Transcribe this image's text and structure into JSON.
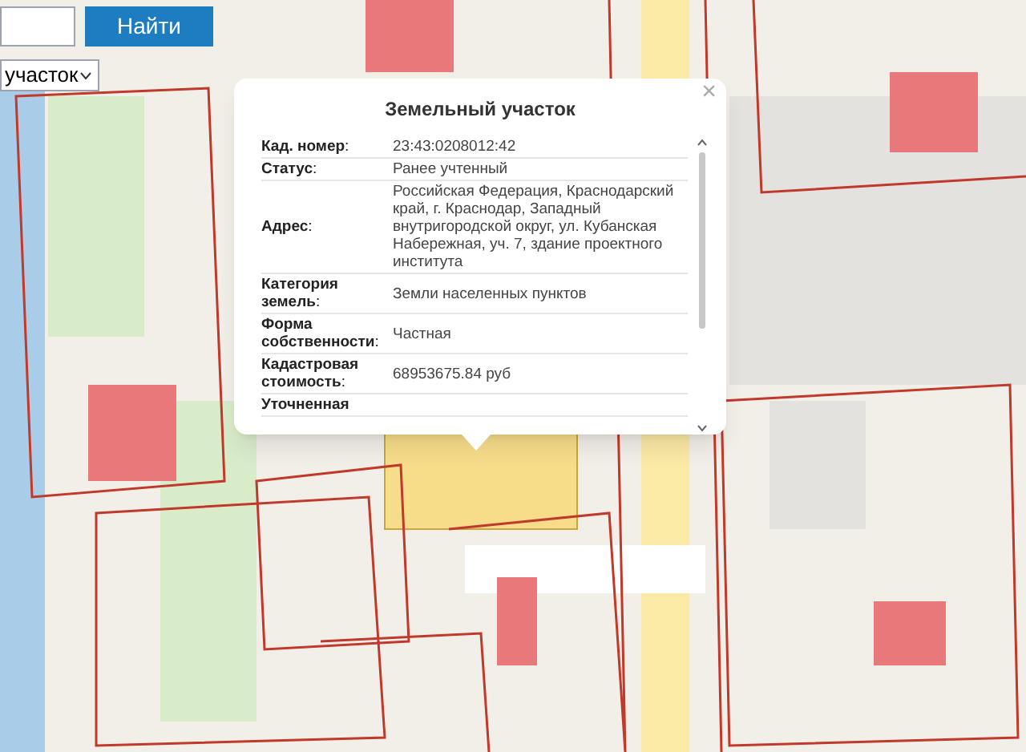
{
  "search": {
    "button": "Найти"
  },
  "layer_select": {
    "value": "участок"
  },
  "popup": {
    "title": "Земельный участок",
    "close": "×",
    "rows": [
      {
        "label": "**Кад. номер**:",
        "value": "23:43:0208012:42"
      },
      {
        "label": "**Статус**:",
        "value": "Ранее учтенный"
      },
      {
        "label": "**Адрес**:",
        "value": "Российская Федерация, Краснодарский край, г. Краснодар, Западный внутригородской округ, ул. Кубанская Набережная, уч. 7, здание проектного института"
      },
      {
        "label": "**Категория земель**:",
        "value": "Земли населенных пунктов"
      },
      {
        "label": "**Форма собственности**:",
        "value": "Частная"
      },
      {
        "label": "**Кадастровая стоимость**:",
        "value": "68953675.84 руб"
      },
      {
        "label": "**Уточненная**"
      }
    ]
  }
}
